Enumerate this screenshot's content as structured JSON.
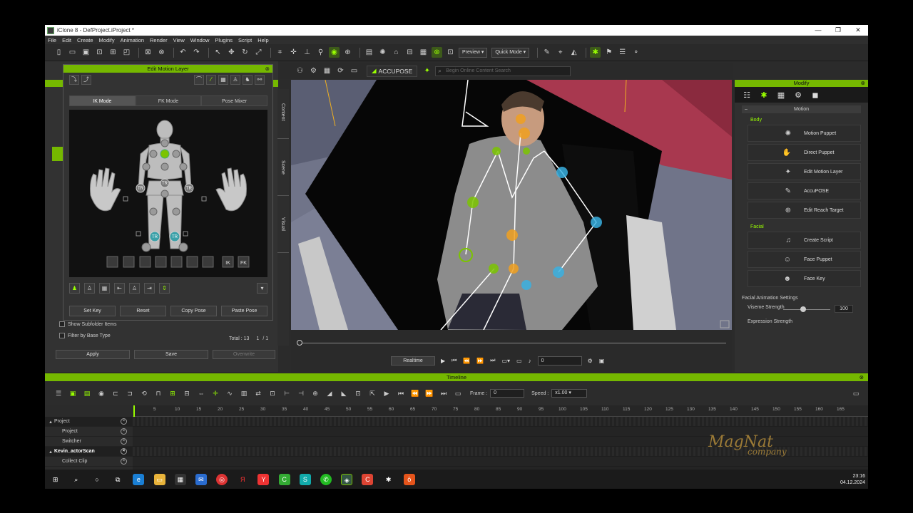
{
  "window": {
    "title": "iClone 8 - DefProject.iProject *",
    "min": "—",
    "max": "❐",
    "close": "✕"
  },
  "menu": [
    "File",
    "Edit",
    "Create",
    "Modify",
    "Animation",
    "Render",
    "View",
    "Window",
    "Plugins",
    "Script",
    "Help"
  ],
  "toolbar": {
    "preview_label": "Preview",
    "quick_mode_label": "Quick Mode"
  },
  "toolbar2": {
    "accupose_label": "ACCUPOSE",
    "search_placeholder": "Begin Online Content Search"
  },
  "edit_motion_layer": {
    "title": "Edit Motion Layer",
    "tabs": [
      "IK Mode",
      "FK Mode",
      "Pose Mixer"
    ],
    "actions": [
      "Set Key",
      "Reset",
      "Copy Pose",
      "Paste Pose"
    ],
    "ik_label": "IK",
    "fk_label": "FK",
    "tr_label": "TR"
  },
  "side_tabs": [
    "Content",
    "Scene",
    "Visual"
  ],
  "left_dock": {
    "show_subfolder": "Show Subfolder Items",
    "filter_base": "Filter by Base Type",
    "total": "Total : 13",
    "page": "1",
    "pages": "/ 1",
    "apply": "Apply",
    "save": "Save",
    "overwrite": "Overwrite"
  },
  "viewport_controls": {
    "realtime": "Realtime",
    "frame_value": "0"
  },
  "modify": {
    "title": "Modify",
    "section_motion": "Motion",
    "group_body": "Body",
    "body_buttons": [
      "Motion Puppet",
      "Direct Puppet",
      "Edit Motion Layer",
      "AccuPOSE",
      "Edit Reach Target"
    ],
    "group_facial": "Facial",
    "facial_buttons": [
      "Create Script",
      "Face Puppet",
      "Face Key"
    ],
    "facial_settings": "Facial Animation Settings",
    "viseme_strength": "Viseme Strength",
    "viseme_value": "100",
    "expression_strength": "Expression Strength"
  },
  "timeline": {
    "title": "Timeline",
    "frame_label": "Frame :",
    "frame_value": "0",
    "speed_label": "Speed :",
    "speed_value": "x1.00",
    "ticks": [
      "5",
      "10",
      "15",
      "20",
      "25",
      "30",
      "35",
      "40",
      "45",
      "50",
      "55",
      "60",
      "65",
      "70",
      "75",
      "80",
      "85",
      "90",
      "95",
      "100",
      "105",
      "110",
      "115",
      "120",
      "125",
      "130",
      "135",
      "140",
      "145",
      "150",
      "155",
      "160",
      "165"
    ],
    "tracks": [
      {
        "label": "Project",
        "level": 0,
        "bold": false,
        "dark": true
      },
      {
        "label": "Project",
        "level": 1,
        "bold": false,
        "dark": false
      },
      {
        "label": "Switcher",
        "level": 1,
        "bold": false,
        "dark": false
      },
      {
        "label": "Kevin_actorScan",
        "level": 0,
        "bold": true,
        "dark": true
      },
      {
        "label": "Collect Clip",
        "level": 1,
        "bold": false,
        "dark": false
      }
    ]
  },
  "watermark": {
    "line1": "MagNat",
    "line2": "company"
  },
  "taskbar": {
    "time": "23:16",
    "date": "04.12.2024"
  }
}
